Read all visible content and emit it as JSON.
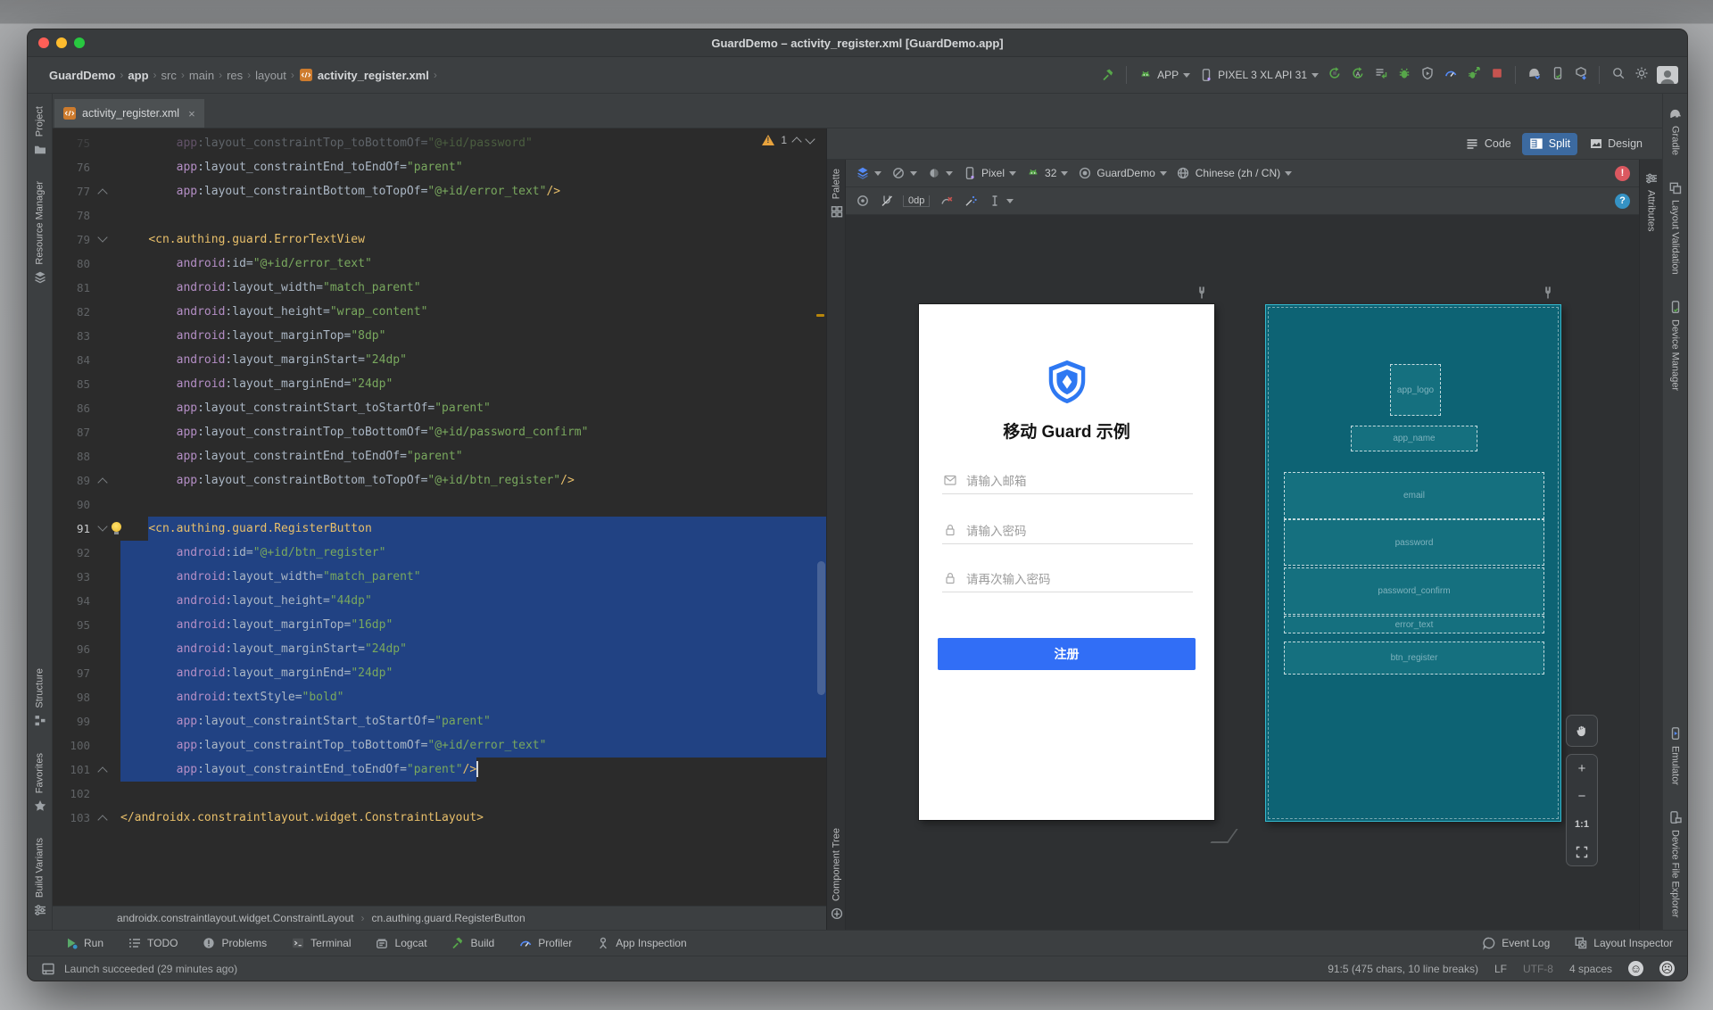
{
  "window": {
    "title": "GuardDemo – activity_register.xml [GuardDemo.app]"
  },
  "toolbar": {
    "breadcrumbs": [
      "GuardDemo",
      "app",
      "src",
      "main",
      "res",
      "layout",
      "activity_register.xml"
    ],
    "run_config": "APP",
    "device": "PIXEL 3 XL API 31",
    "icons": [
      "build-hammer-icon",
      "run-config-android-icon",
      "device-phone-icon",
      "rerun-icon",
      "apply-changes-icon",
      "apply-code-changes-icon",
      "debug-icon",
      "coverage-icon",
      "profiler-icon",
      "attach-debugger-icon",
      "stop-icon",
      "gradle-sync-icon",
      "device-manager-icon",
      "sdk-manager-icon",
      "search-icon",
      "settings-icon",
      "avatar"
    ]
  },
  "left_strip": {
    "top": [
      {
        "label": "Project",
        "icon": "project-icon"
      },
      {
        "label": "Resource Manager",
        "icon": "resource-manager-icon"
      }
    ],
    "bottom": [
      {
        "label": "Structure",
        "icon": "structure-icon"
      },
      {
        "label": "Favorites",
        "icon": "star-icon"
      },
      {
        "label": "Build Variants",
        "icon": "build-variants-icon"
      }
    ]
  },
  "right_strip": {
    "top": [
      {
        "label": "Gradle",
        "icon": "gradle-icon"
      },
      {
        "label": "Layout Validation",
        "icon": "layout-validation-icon"
      },
      {
        "label": "Device Manager",
        "icon": "device-manager-icon"
      }
    ],
    "bottom": [
      {
        "label": "Emulator",
        "icon": "emulator-icon"
      },
      {
        "label": "Device File Explorer",
        "icon": "device-file-explorer-icon"
      }
    ]
  },
  "editor": {
    "tab": {
      "label": "activity_register.xml"
    },
    "inspection_warnings": "1",
    "breadcrumb": [
      "androidx.constraintlayout.widget.ConstraintLayout",
      "cn.authing.guard.RegisterButton"
    ],
    "lines": [
      {
        "n": 75,
        "ind": 8,
        "dim": true,
        "t": [
          [
            "n",
            "app"
          ],
          [
            "p",
            ":"
          ],
          [
            "a",
            "layout_constraintTop_toBottomOf"
          ],
          [
            "p",
            "="
          ],
          [
            "v",
            "\"@+id/password\""
          ]
        ]
      },
      {
        "n": 76,
        "ind": 8,
        "t": [
          [
            "n",
            "app"
          ],
          [
            "p",
            ":"
          ],
          [
            "a",
            "layout_constraintEnd_toEndOf"
          ],
          [
            "p",
            "="
          ],
          [
            "v",
            "\"parent\""
          ]
        ]
      },
      {
        "n": 77,
        "ind": 8,
        "fold": "up",
        "t": [
          [
            "n",
            "app"
          ],
          [
            "p",
            ":"
          ],
          [
            "a",
            "layout_constraintBottom_toTopOf"
          ],
          [
            "p",
            "="
          ],
          [
            "v",
            "\"@+id/error_text\""
          ],
          [
            "t",
            "/>"
          ]
        ]
      },
      {
        "n": 78,
        "ind": 0,
        "t": []
      },
      {
        "n": 79,
        "ind": 4,
        "fold": "down",
        "t": [
          [
            "t",
            "<cn.authing.guard.ErrorTextView"
          ]
        ]
      },
      {
        "n": 80,
        "ind": 8,
        "t": [
          [
            "n",
            "android"
          ],
          [
            "p",
            ":"
          ],
          [
            "a",
            "id"
          ],
          [
            "p",
            "="
          ],
          [
            "v",
            "\"@+id/error_text\""
          ]
        ]
      },
      {
        "n": 81,
        "ind": 8,
        "t": [
          [
            "n",
            "android"
          ],
          [
            "p",
            ":"
          ],
          [
            "a",
            "layout_width"
          ],
          [
            "p",
            "="
          ],
          [
            "v",
            "\"match_parent\""
          ]
        ]
      },
      {
        "n": 82,
        "ind": 8,
        "t": [
          [
            "n",
            "android"
          ],
          [
            "p",
            ":"
          ],
          [
            "a",
            "layout_height"
          ],
          [
            "p",
            "="
          ],
          [
            "v",
            "\"wrap_content\""
          ]
        ]
      },
      {
        "n": 83,
        "ind": 8,
        "t": [
          [
            "n",
            "android"
          ],
          [
            "p",
            ":"
          ],
          [
            "a",
            "layout_marginTop"
          ],
          [
            "p",
            "="
          ],
          [
            "v",
            "\"8dp\""
          ]
        ]
      },
      {
        "n": 84,
        "ind": 8,
        "t": [
          [
            "n",
            "android"
          ],
          [
            "p",
            ":"
          ],
          [
            "a",
            "layout_marginStart"
          ],
          [
            "p",
            "="
          ],
          [
            "v",
            "\"24dp\""
          ]
        ]
      },
      {
        "n": 85,
        "ind": 8,
        "t": [
          [
            "n",
            "android"
          ],
          [
            "p",
            ":"
          ],
          [
            "a",
            "layout_marginEnd"
          ],
          [
            "p",
            "="
          ],
          [
            "v",
            "\"24dp\""
          ]
        ]
      },
      {
        "n": 86,
        "ind": 8,
        "t": [
          [
            "n",
            "app"
          ],
          [
            "p",
            ":"
          ],
          [
            "a",
            "layout_constraintStart_toStartOf"
          ],
          [
            "p",
            "="
          ],
          [
            "v",
            "\"parent\""
          ]
        ]
      },
      {
        "n": 87,
        "ind": 8,
        "t": [
          [
            "n",
            "app"
          ],
          [
            "p",
            ":"
          ],
          [
            "a",
            "layout_constraintTop_toBottomOf"
          ],
          [
            "p",
            "="
          ],
          [
            "v",
            "\"@+id/password_confirm\""
          ]
        ]
      },
      {
        "n": 88,
        "ind": 8,
        "t": [
          [
            "n",
            "app"
          ],
          [
            "p",
            ":"
          ],
          [
            "a",
            "layout_constraintEnd_toEndOf"
          ],
          [
            "p",
            "="
          ],
          [
            "v",
            "\"parent\""
          ]
        ]
      },
      {
        "n": 89,
        "ind": 8,
        "fold": "up",
        "t": [
          [
            "n",
            "app"
          ],
          [
            "p",
            ":"
          ],
          [
            "a",
            "layout_constraintBottom_toTopOf"
          ],
          [
            "p",
            "="
          ],
          [
            "v",
            "\"@+id/btn_register\""
          ],
          [
            "t",
            "/>"
          ]
        ]
      },
      {
        "n": 90,
        "ind": 0,
        "t": []
      },
      {
        "n": 91,
        "ind": 4,
        "fold": "down",
        "bulb": true,
        "sel": "from",
        "t": [
          [
            "t",
            "<cn.authing.guard.RegisterButton"
          ]
        ]
      },
      {
        "n": 92,
        "ind": 8,
        "sel": "full",
        "t": [
          [
            "n",
            "android"
          ],
          [
            "p",
            ":"
          ],
          [
            "a",
            "id"
          ],
          [
            "p",
            "="
          ],
          [
            "v",
            "\"@+id/btn_register\""
          ]
        ]
      },
      {
        "n": 93,
        "ind": 8,
        "sel": "full",
        "t": [
          [
            "n",
            "android"
          ],
          [
            "p",
            ":"
          ],
          [
            "a",
            "layout_width"
          ],
          [
            "p",
            "="
          ],
          [
            "v",
            "\"match_parent\""
          ]
        ]
      },
      {
        "n": 94,
        "ind": 8,
        "sel": "full",
        "t": [
          [
            "n",
            "android"
          ],
          [
            "p",
            ":"
          ],
          [
            "a",
            "layout_height"
          ],
          [
            "p",
            "="
          ],
          [
            "v",
            "\"44dp\""
          ]
        ]
      },
      {
        "n": 95,
        "ind": 8,
        "sel": "full",
        "t": [
          [
            "n",
            "android"
          ],
          [
            "p",
            ":"
          ],
          [
            "a",
            "layout_marginTop"
          ],
          [
            "p",
            "="
          ],
          [
            "v",
            "\"16dp\""
          ]
        ]
      },
      {
        "n": 96,
        "ind": 8,
        "sel": "full",
        "t": [
          [
            "n",
            "android"
          ],
          [
            "p",
            ":"
          ],
          [
            "a",
            "layout_marginStart"
          ],
          [
            "p",
            "="
          ],
          [
            "v",
            "\"24dp\""
          ]
        ]
      },
      {
        "n": 97,
        "ind": 8,
        "sel": "full",
        "t": [
          [
            "n",
            "android"
          ],
          [
            "p",
            ":"
          ],
          [
            "a",
            "layout_marginEnd"
          ],
          [
            "p",
            "="
          ],
          [
            "v",
            "\"24dp\""
          ]
        ]
      },
      {
        "n": 98,
        "ind": 8,
        "sel": "full",
        "t": [
          [
            "n",
            "android"
          ],
          [
            "p",
            ":"
          ],
          [
            "a",
            "textStyle"
          ],
          [
            "p",
            "="
          ],
          [
            "v",
            "\"bold\""
          ]
        ]
      },
      {
        "n": 99,
        "ind": 8,
        "sel": "full",
        "t": [
          [
            "n",
            "app"
          ],
          [
            "p",
            ":"
          ],
          [
            "a",
            "layout_constraintStart_toStartOf"
          ],
          [
            "p",
            "="
          ],
          [
            "v",
            "\"parent\""
          ]
        ]
      },
      {
        "n": 100,
        "ind": 8,
        "sel": "full",
        "t": [
          [
            "n",
            "app"
          ],
          [
            "p",
            ":"
          ],
          [
            "a",
            "layout_constraintTop_toBottomOf"
          ],
          [
            "p",
            "="
          ],
          [
            "v",
            "\"@+id/error_text\""
          ]
        ]
      },
      {
        "n": 101,
        "ind": 8,
        "sel": "to",
        "fold": "up",
        "caret": true,
        "t": [
          [
            "n",
            "app"
          ],
          [
            "p",
            ":"
          ],
          [
            "a",
            "layout_constraintEnd_toEndOf"
          ],
          [
            "p",
            "="
          ],
          [
            "v",
            "\"parent\""
          ],
          [
            "t",
            "/>"
          ]
        ]
      },
      {
        "n": 102,
        "ind": 0,
        "t": []
      },
      {
        "n": 103,
        "ind": 0,
        "fold": "up",
        "t": [
          [
            "t",
            "</androidx.constraintlayout.widget.ConstraintLayout>"
          ]
        ]
      }
    ]
  },
  "design": {
    "modes": [
      {
        "label": "Code",
        "icon": "code-mode-icon"
      },
      {
        "label": "Split",
        "icon": "split-mode-icon"
      },
      {
        "label": "Design",
        "icon": "design-mode-icon"
      }
    ],
    "active_mode": "Split",
    "toolbar1": {
      "device": "Pixel",
      "api": "32",
      "theme": "GuardDemo",
      "locale": "Chinese (zh / CN)",
      "error_badge": "!"
    },
    "toolbar2": {
      "default_margin": "0dp",
      "help_badge": "?"
    },
    "palette_label": "Palette",
    "component_tree_label": "Component Tree",
    "attributes_label": "Attributes",
    "zoom": {
      "plus": "+",
      "minus": "−",
      "one_to_one": "1:1"
    },
    "preview": {
      "title": "移动 Guard 示例",
      "fields": [
        {
          "icon": "mail-icon",
          "placeholder": "请输入邮箱"
        },
        {
          "icon": "lock-icon",
          "placeholder": "请输入密码"
        },
        {
          "icon": "lock-icon",
          "placeholder": "请再次输入密码"
        }
      ],
      "button": "注册",
      "accent_color": "#316ef6",
      "logo_color": "#2e78f2"
    },
    "blueprint": {
      "background": "#0d6374",
      "boxes": [
        "app_logo",
        "app_name",
        "email",
        "password",
        "password_confirm",
        "error_text",
        "btn_register"
      ]
    }
  },
  "bottom_bar": {
    "left": [
      {
        "label": "Run",
        "icon": "run-icon"
      },
      {
        "label": "TODO",
        "icon": "todo-icon"
      },
      {
        "label": "Problems",
        "icon": "problems-icon"
      },
      {
        "label": "Terminal",
        "icon": "terminal-icon"
      },
      {
        "label": "Logcat",
        "icon": "logcat-icon"
      },
      {
        "label": "Build",
        "icon": "build-hammer-icon"
      },
      {
        "label": "Profiler",
        "icon": "profiler-icon"
      },
      {
        "label": "App Inspection",
        "icon": "app-inspection-icon"
      }
    ],
    "right": [
      {
        "label": "Event Log",
        "icon": "event-log-icon"
      },
      {
        "label": "Layout Inspector",
        "icon": "layout-inspector-icon"
      }
    ]
  },
  "status_bar": {
    "message": "Launch succeeded (29 minutes ago)",
    "caret_position": "91:5 (475 chars, 10 line breaks)",
    "line_separator": "LF",
    "encoding": "UTF-8",
    "indent": "4 spaces",
    "smileys": [
      "☺",
      "☹"
    ]
  }
}
